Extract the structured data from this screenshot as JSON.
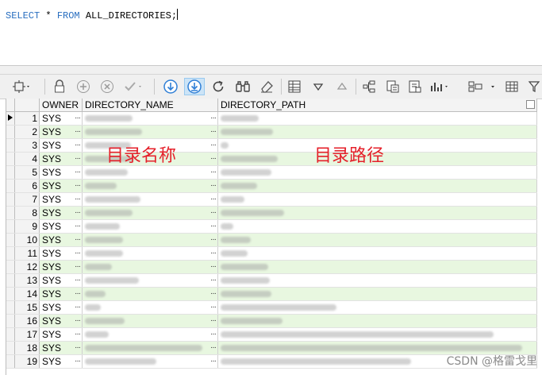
{
  "editor": {
    "sql_keyword_select": "SELECT",
    "sql_star": "*",
    "sql_keyword_from": "FROM",
    "sql_rest": "ALL_DIRECTORIES;"
  },
  "grid": {
    "columns": [
      "OWNER",
      "DIRECTORY_NAME",
      "DIRECTORY_PATH"
    ],
    "rows": [
      {
        "num": "1",
        "owner": "SYS",
        "name_w": 60,
        "path_w": 48
      },
      {
        "num": "2",
        "owner": "SYS",
        "name_w": 72,
        "path_w": 66
      },
      {
        "num": "3",
        "owner": "SYS",
        "name_w": 58,
        "path_w": 10
      },
      {
        "num": "4",
        "owner": "SYS",
        "name_w": 62,
        "path_w": 72
      },
      {
        "num": "5",
        "owner": "SYS",
        "name_w": 54,
        "path_w": 64
      },
      {
        "num": "6",
        "owner": "SYS",
        "name_w": 40,
        "path_w": 46
      },
      {
        "num": "7",
        "owner": "SYS",
        "name_w": 70,
        "path_w": 30
      },
      {
        "num": "8",
        "owner": "SYS",
        "name_w": 60,
        "path_w": 80
      },
      {
        "num": "9",
        "owner": "SYS",
        "name_w": 44,
        "path_w": 16
      },
      {
        "num": "10",
        "owner": "SYS",
        "name_w": 48,
        "path_w": 38
      },
      {
        "num": "11",
        "owner": "SYS",
        "name_w": 48,
        "path_w": 34
      },
      {
        "num": "12",
        "owner": "SYS",
        "name_w": 34,
        "path_w": 60
      },
      {
        "num": "13",
        "owner": "SYS",
        "name_w": 68,
        "path_w": 62
      },
      {
        "num": "14",
        "owner": "SYS",
        "name_w": 26,
        "path_w": 64
      },
      {
        "num": "15",
        "owner": "SYS",
        "name_w": 20,
        "path_w": 146
      },
      {
        "num": "16",
        "owner": "SYS",
        "name_w": 50,
        "path_w": 78
      },
      {
        "num": "17",
        "owner": "SYS",
        "name_w": 30,
        "path_w": 344
      },
      {
        "num": "18",
        "owner": "SYS",
        "name_w": 148,
        "path_w": 380
      },
      {
        "num": "19",
        "owner": "SYS",
        "name_w": 90,
        "path_w": 240
      }
    ]
  },
  "annotations": {
    "name_label": "目录名称",
    "path_label": "目录路径"
  },
  "watermark": "CSDN @格雷戈里"
}
